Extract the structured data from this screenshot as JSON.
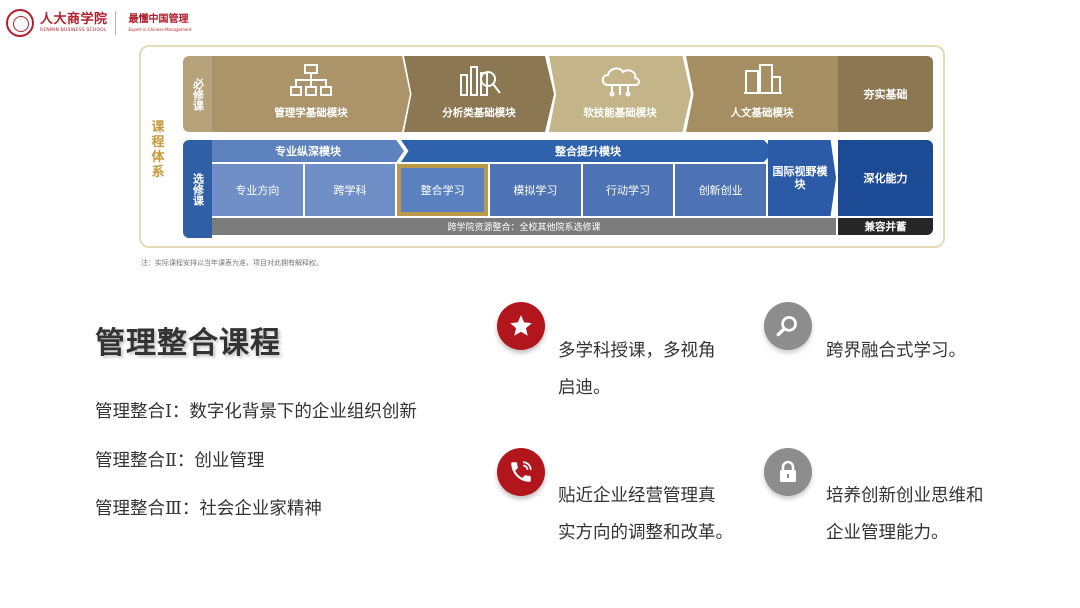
{
  "header": {
    "school_cn": "人大商学院",
    "school_en": "RENMIN BUSINESS SCHOOL",
    "slogan_cn": "最懂中国管理",
    "slogan_en": "Expert in Chinese Management"
  },
  "diagram": {
    "system_label": "课程体系",
    "required": {
      "label": "必修课",
      "modules": [
        "管理学基础模块",
        "分析类基础模块",
        "软技能基础模块",
        "人文基础模块"
      ],
      "end_label": "夯实基础"
    },
    "elective": {
      "label": "选修课",
      "band_left": "专业纵深模块",
      "band_right": "整合提升模块",
      "cells": [
        "专业方向",
        "跨学科",
        "整合学习",
        "模拟学习",
        "行动学习",
        "创新创业"
      ],
      "intl": "国际视野模块",
      "deep": "深化能力",
      "cross": "跨学院资源整合：全校其他院系选修课",
      "inclusive": "兼容并蓄"
    },
    "note": "注：实际课程安排以当年课表为准，项目对此拥有解释权。"
  },
  "section": {
    "title": "管理整合课程",
    "courses": [
      "管理整合Ⅰ：数字化背景下的企业组织创新",
      "管理整合Ⅱ：创业管理",
      "管理整合Ⅲ：社会企业家精神"
    ]
  },
  "features": [
    {
      "icon": "star-icon",
      "line1": "多学科授课，多视角",
      "line2": "启迪。"
    },
    {
      "icon": "magnifier-icon",
      "line1": "跨界融合式学习。",
      "line2": ""
    },
    {
      "icon": "phone-icon",
      "line1": "贴近企业经营管理真",
      "line2": "实方向的调整和改革。"
    },
    {
      "icon": "lock-icon",
      "line1": "培养创新创业思维和",
      "line2": "企业管理能力。"
    }
  ],
  "colors": {
    "brand_red": "#b21f2d",
    "gold": "#ab946a",
    "blue": "#2e62ad",
    "highlight_border": "#b99a4a"
  }
}
